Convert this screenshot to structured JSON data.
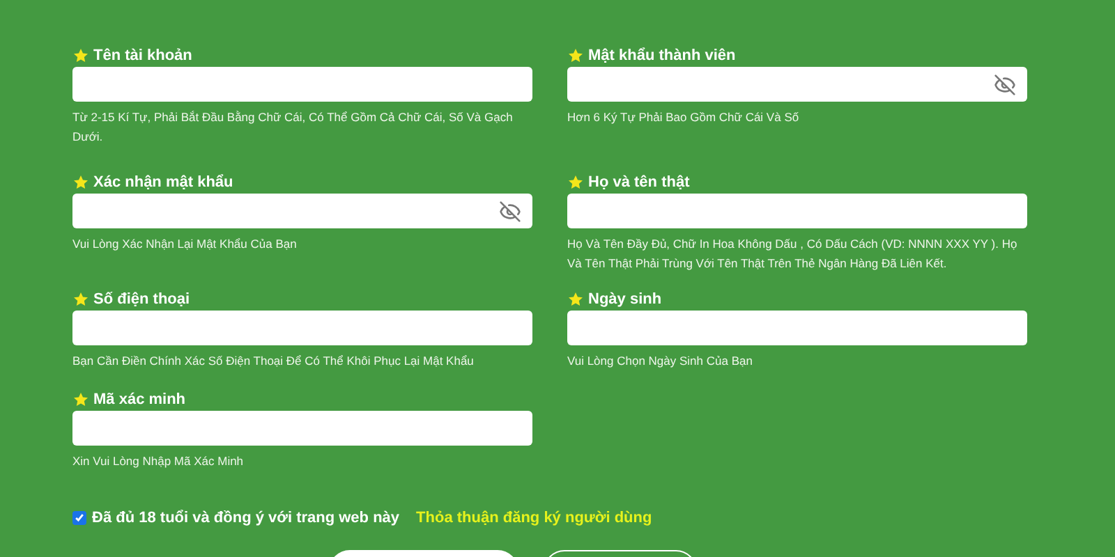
{
  "fields": [
    {
      "label": "Tên tài khoản",
      "kind": "text",
      "hint": "Từ 2-15 Kí Tự, Phải Bắt Đầu Bằng Chữ Cái, Có Thể Gồm Cả Chữ Cái, Số Và Gạch Dưới."
    },
    {
      "label": "Mật khẩu thành viên",
      "kind": "password",
      "hint": "Hơn 6 Ký Tự Phải Bao Gồm Chữ Cái Và Số"
    },
    {
      "label": "Xác nhận mật khẩu",
      "kind": "password",
      "hint": "Vui Lòng Xác Nhận Lại Mật Khẩu Của Bạn"
    },
    {
      "label": "Họ và tên thật",
      "kind": "text",
      "hint": "Họ Và Tên Đầy Đủ, Chữ In Hoa Không Dấu , Có Dấu Cách (VD: NNNN XXX YY ). Họ Và Tên Thật Phải Trùng Với Tên Thật Trên Thẻ Ngân Hàng Đã Liên Kết."
    },
    {
      "label": "Số điện thoại",
      "kind": "text",
      "hint": "Bạn Cần Điền Chính Xác Số Điện Thoại Để Có Thể Khôi Phục Lại Mật Khẩu"
    },
    {
      "label": "Ngày sinh",
      "kind": "text",
      "hint": "Vui Lòng Chọn Ngày Sinh Của Bạn"
    },
    {
      "label": "Mã xác minh",
      "kind": "text",
      "hint": "Xin Vui Lòng Nhập Mã Xác Minh"
    }
  ],
  "agreement": {
    "checked": true,
    "text": "Đã đủ 18 tuổi và đồng ý với trang web này",
    "link": "Thỏa thuận đăng ký người dùng"
  }
}
